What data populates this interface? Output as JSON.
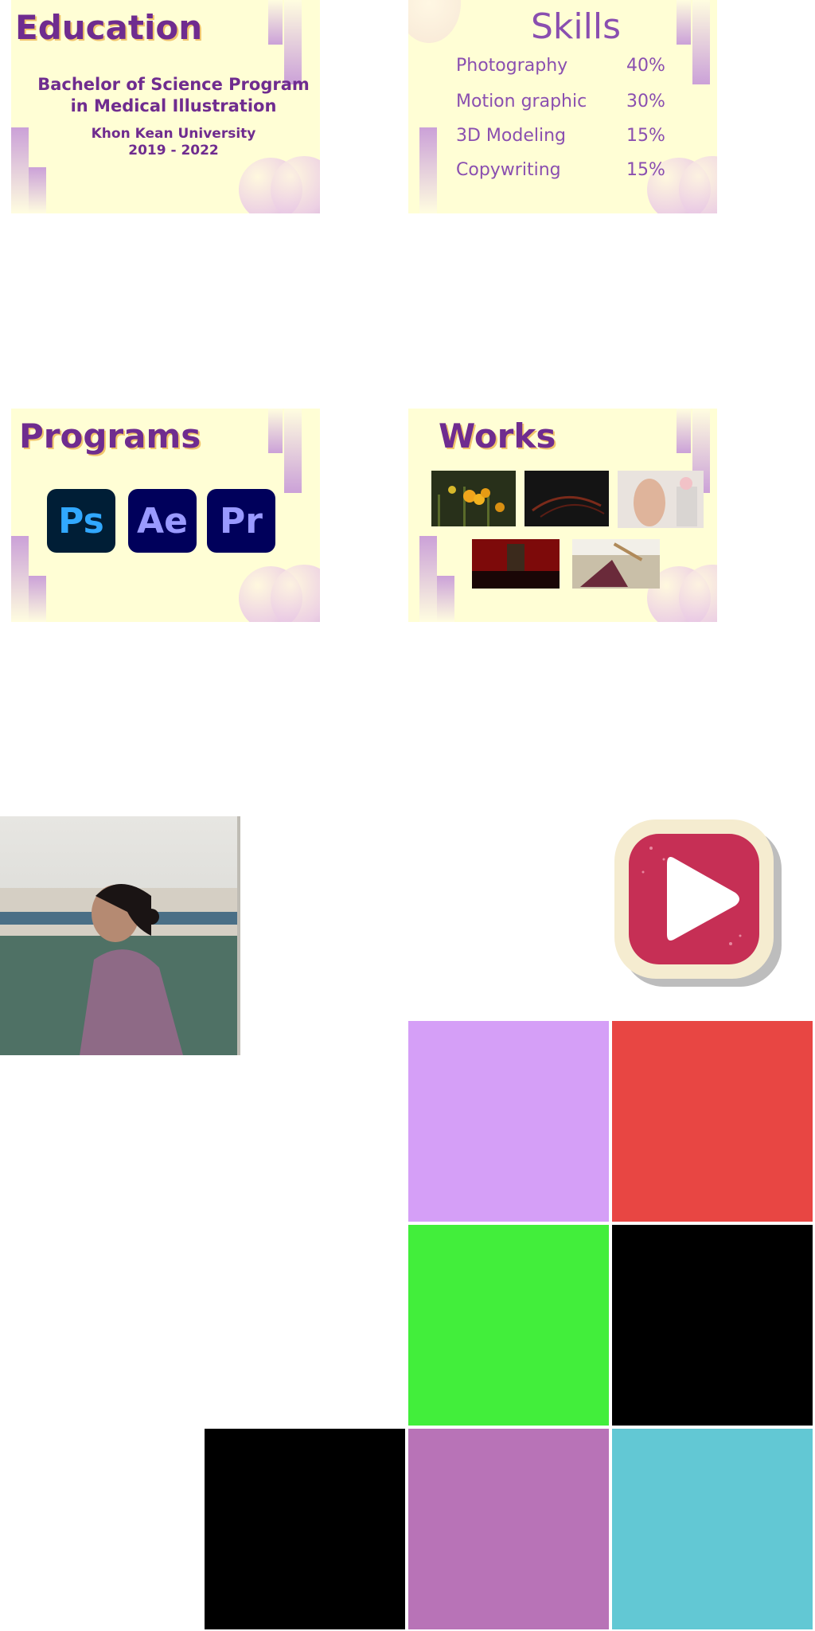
{
  "education": {
    "title": "Education",
    "degree_line1": "Bachelor of Science Program",
    "degree_line2": "in Medical Illustration",
    "university": "Khon Kean University",
    "years": "2019 - 2022"
  },
  "skills": {
    "title": "Skills",
    "items": [
      {
        "name": "Photography",
        "percent": "40%"
      },
      {
        "name": "Motion graphic",
        "percent": "30%"
      },
      {
        "name": "3D Modeling",
        "percent": "15%"
      },
      {
        "name": "Copywriting",
        "percent": "15%"
      }
    ]
  },
  "programs": {
    "title": "Programs",
    "apps": [
      {
        "label": "Ps",
        "bg": "#001e36",
        "fg": "#31a8ff"
      },
      {
        "label": "Ae",
        "bg": "#00005b",
        "fg": "#9999ff"
      },
      {
        "label": "Pr",
        "bg": "#00005b",
        "fg": "#9999ff"
      }
    ]
  },
  "works": {
    "title": "Works"
  },
  "play_button": {
    "icon": "play-icon"
  },
  "color_tiles": [
    {
      "color": "#d59ff7"
    },
    {
      "color": "#e84643"
    },
    {
      "color": "#42ee3b"
    },
    {
      "color": "#000000"
    },
    {
      "color": "#000000"
    },
    {
      "color": "#b873b7"
    },
    {
      "color": "#62c8d4"
    }
  ]
}
